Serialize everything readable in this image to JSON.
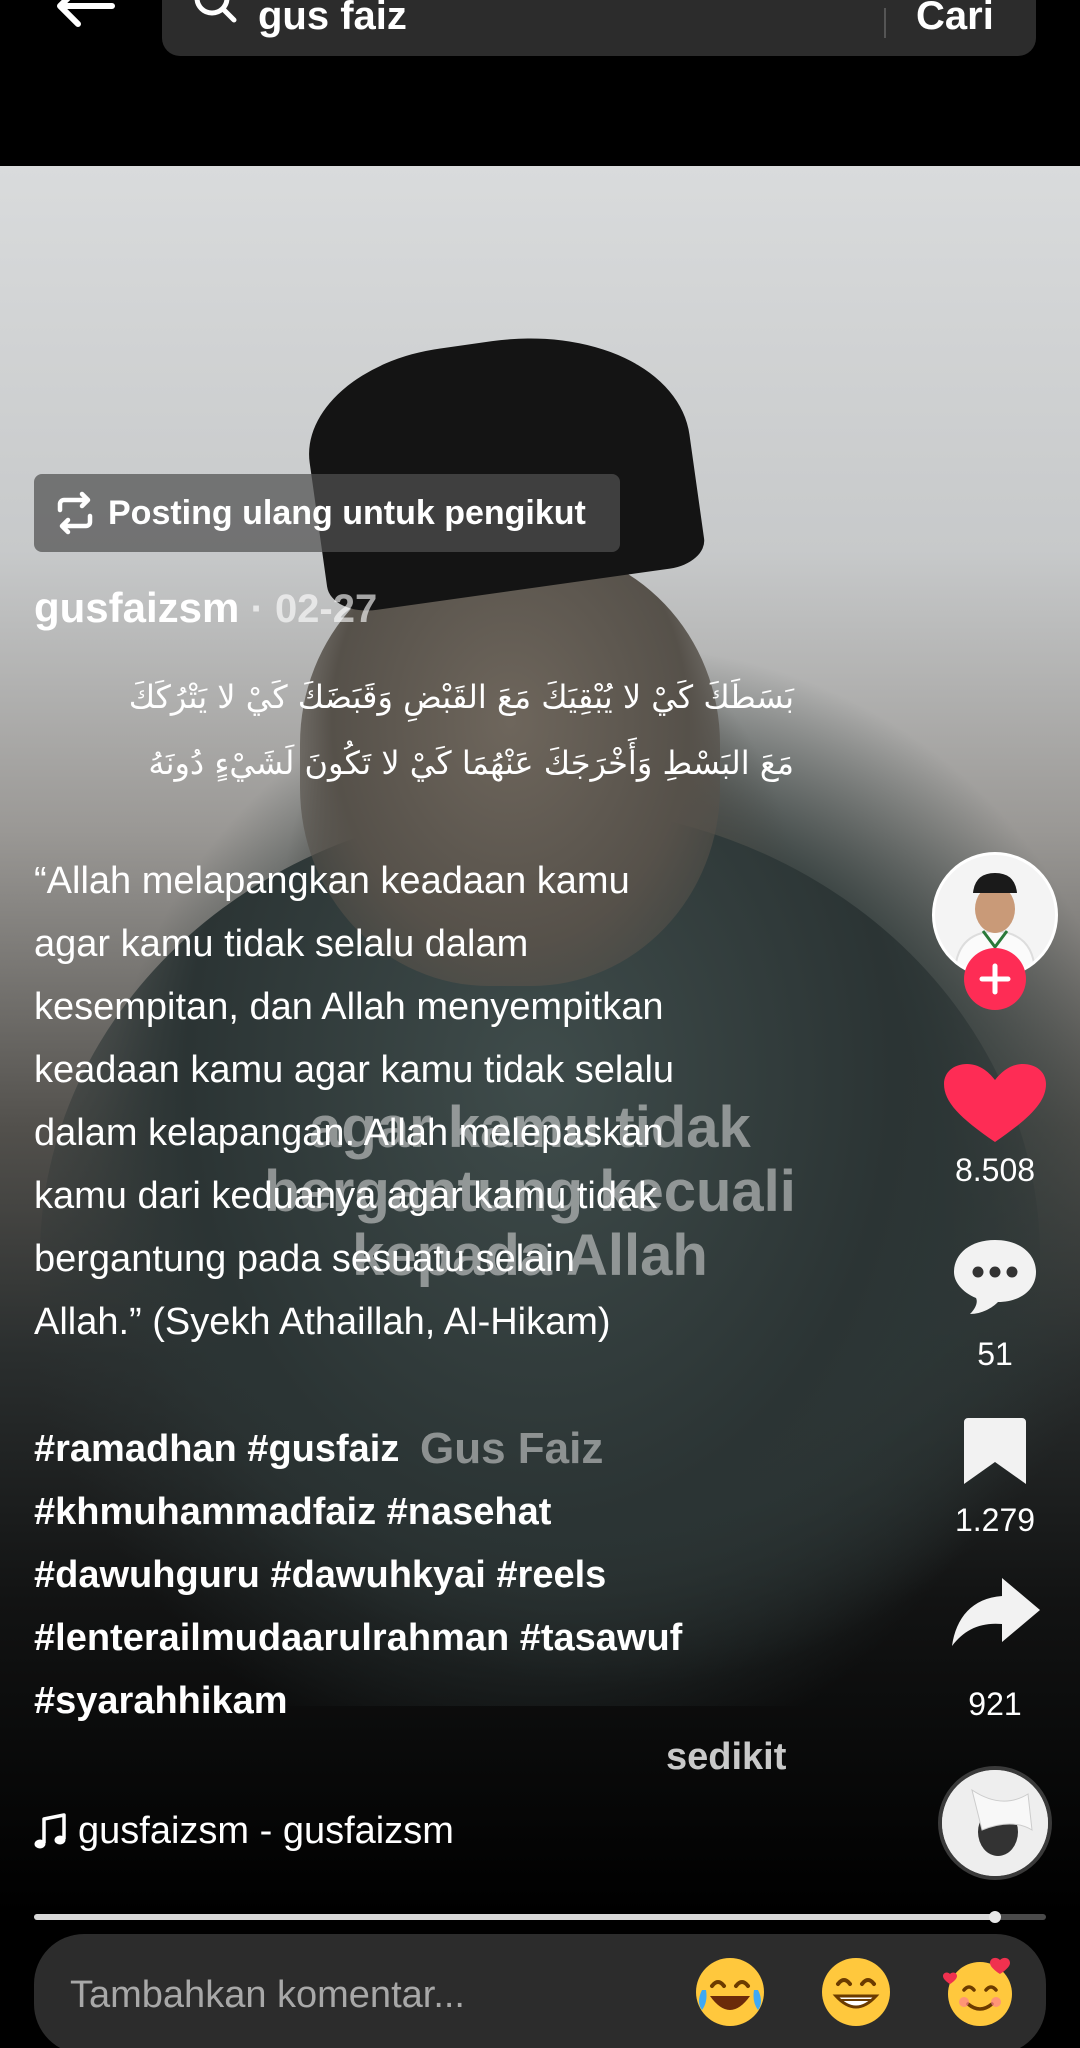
{
  "search": {
    "query": "gus faiz",
    "submit_label": "Cari"
  },
  "video": {
    "overlay_caption_lines": [
      "agar kamu tidak",
      "bergantung kecuali",
      "kepada Allah"
    ],
    "overlay_watermark": "Gus Faiz"
  },
  "repost": {
    "label": "Posting ulang untuk pengikut"
  },
  "post": {
    "author": "gusfaizsm",
    "date": " · 02-27",
    "arabic_lines": [
      "بَسَطَكَ كَيْ لا يُبْقِيَكَ مَعَ القَبْضِ وَقَبَضَكَ كَيْ لا يَتْرُكَكَ",
      "مَعَ البَسْطِ وَأَخْرَجَكَ عَنْهُمَا كَيْ لا تَكُونَ لَشَيْءٍ دُونَهُ"
    ],
    "quote_lines": [
      "“Allah melapangkan keadaan kamu",
      "agar kamu tidak selalu dalam",
      "kesempitan, dan Allah menyempitkan",
      "keadaan kamu agar kamu tidak selalu",
      "dalam kelapangan. Allah melepaskan",
      "kamu dari keduanya agar kamu tidak",
      "bergantung pada sesuatu selain",
      "Allah.” (Syekh Athaillah, Al-Hikam)"
    ],
    "hashtag_lines": [
      "#ramadhan #gusfaiz",
      "#khmuhammadfaiz #nasehat",
      "#dawuhguru #dawuhkyai #reels",
      "#lenterailmudaarulrahman #tasawuf",
      "#syarahhikam"
    ],
    "less_label": "sedikit",
    "music": "gusfaizsm - gusfaizsm"
  },
  "actions": {
    "likes": "8.508",
    "comments": "51",
    "bookmarks": "1.279",
    "shares": "921",
    "like_color": "#fe2c55"
  },
  "progress": {
    "fraction": 0.95
  },
  "comment_bar": {
    "placeholder": "Tambahkan komentar...",
    "emojis": [
      "face-with-tears-of-joy",
      "beaming-face",
      "smiling-face-with-hearts"
    ]
  }
}
